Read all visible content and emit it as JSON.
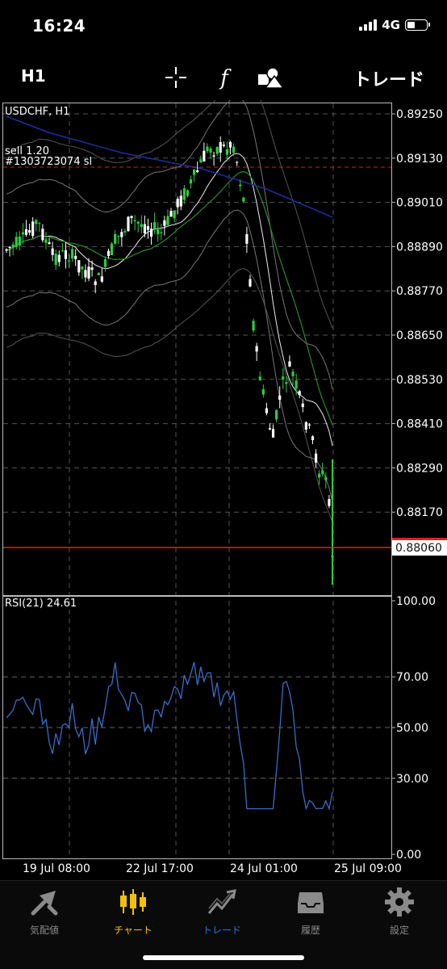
{
  "status": {
    "time": "16:24",
    "network": "4G"
  },
  "toolbar": {
    "timeframe": "H1",
    "trade_label": "トレード"
  },
  "chart": {
    "symbol_label": "USDCHF, H1",
    "order_label": "sell 1.20",
    "order_id": "#1303723074 sl",
    "current_price": "0.88060",
    "price_ticks": [
      "0.89250",
      "0.89130",
      "0.89010",
      "0.88890",
      "0.88770",
      "0.88650",
      "0.88530",
      "0.88410",
      "0.88290",
      "0.88170"
    ],
    "rsi_label": "RSI(21) 24.61",
    "rsi_ticks": [
      "100.00",
      "70.00",
      "50.00",
      "30.00",
      "0.00"
    ],
    "x_labels": [
      "19 Jul 08:00",
      "22 Jul 17:00",
      "24 Jul 01:00",
      "25 Jul 09:00"
    ],
    "colors": {
      "bull": "#2ecc40",
      "bear": "#ffffff",
      "sl_line": "#cc2222",
      "price_line": "#e02020",
      "rsi_line": "#3a6cc8",
      "ma_slow": "#1c2fa0",
      "ma_mid": "#2a8a2a"
    }
  },
  "chart_data": {
    "type": "line",
    "rsi": {
      "period": 21,
      "current": 24.61,
      "ylim": [
        0,
        100
      ],
      "levels": [
        30,
        50,
        70
      ]
    },
    "price": {
      "current": 0.8806,
      "ylim": [
        0.8801,
        0.8934
      ]
    }
  },
  "tabs": [
    {
      "label": "気配値",
      "icon": "quotes-icon",
      "color": "#8a8a8a"
    },
    {
      "label": "チャート",
      "icon": "chart-icon",
      "color": "#f2c200"
    },
    {
      "label": "トレード",
      "icon": "trade-icon",
      "color": "#2e6fe0"
    },
    {
      "label": "履歴",
      "icon": "history-icon",
      "color": "#8a8a8a"
    },
    {
      "label": "設定",
      "icon": "settings-icon",
      "color": "#8a8a8a"
    }
  ]
}
